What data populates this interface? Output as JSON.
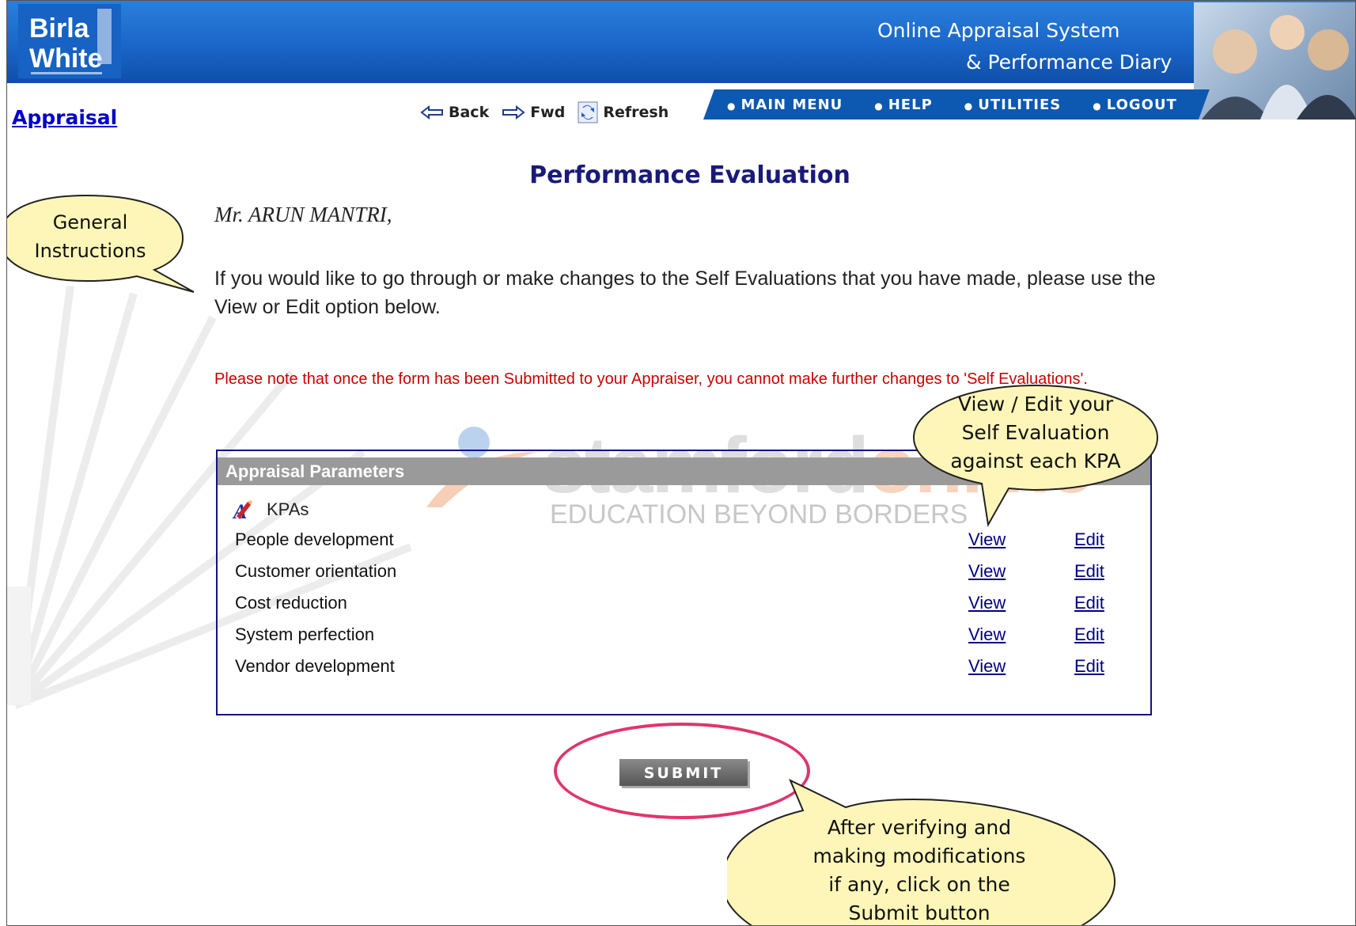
{
  "header": {
    "logo_line1": "Birla",
    "logo_line2": "White",
    "app_title_line1": "Online Appraisal System",
    "app_title_line2": "& Performance Diary",
    "colors": {
      "header_blue": "#1a66c8",
      "menu_blue": "#0d58b0"
    }
  },
  "menu": {
    "items": [
      {
        "label": "MAIN MENU"
      },
      {
        "label": "HELP"
      },
      {
        "label": "UTILITIES"
      },
      {
        "label": "LOGOUT"
      }
    ]
  },
  "breadcrumb": {
    "link": "Appraisal"
  },
  "nav": {
    "back": "Back",
    "fwd": "Fwd",
    "refresh": "Refresh"
  },
  "main": {
    "title": "Performance Evaluation",
    "greeting": "Mr. ARUN MANTRI,",
    "instruction": "If you would like to go through or make changes to the Self Evaluations that you have made, please use the View or Edit option below.",
    "note": "Please note that once the form has been Submitted to your Appraiser, you cannot make further changes to 'Self Evaluations'.",
    "note_color": "#cc0000"
  },
  "watermark": {
    "brand_a": "stamford",
    "brand_b": "online",
    "tagline": "EDUCATION BEYOND BORDERS"
  },
  "parameters": {
    "header": "Appraisal Parameters",
    "section": "KPAs",
    "rows": [
      {
        "label": "People development",
        "view": "View",
        "edit": "Edit"
      },
      {
        "label": "Customer orientation",
        "view": "View",
        "edit": "Edit"
      },
      {
        "label": "Cost reduction",
        "view": "View",
        "edit": "Edit"
      },
      {
        "label": "System perfection",
        "view": "View",
        "edit": "Edit"
      },
      {
        "label": "Vendor development",
        "view": "View",
        "edit": "Edit"
      }
    ]
  },
  "submit": {
    "label": "SUBMIT",
    "highlight_color": "#e0356c"
  },
  "callouts": {
    "general_line1": "General",
    "general_line2": "Instructions",
    "view_edit_line1": "View / Edit your",
    "view_edit_line2": "Self Evaluation",
    "view_edit_line3": "against each KPA",
    "submit_line1": "After verifying  and",
    "submit_line2": "making modifications",
    "submit_line3": "if any, click on the",
    "submit_line4": "Submit button",
    "fill_color": "#fdf6b8"
  }
}
